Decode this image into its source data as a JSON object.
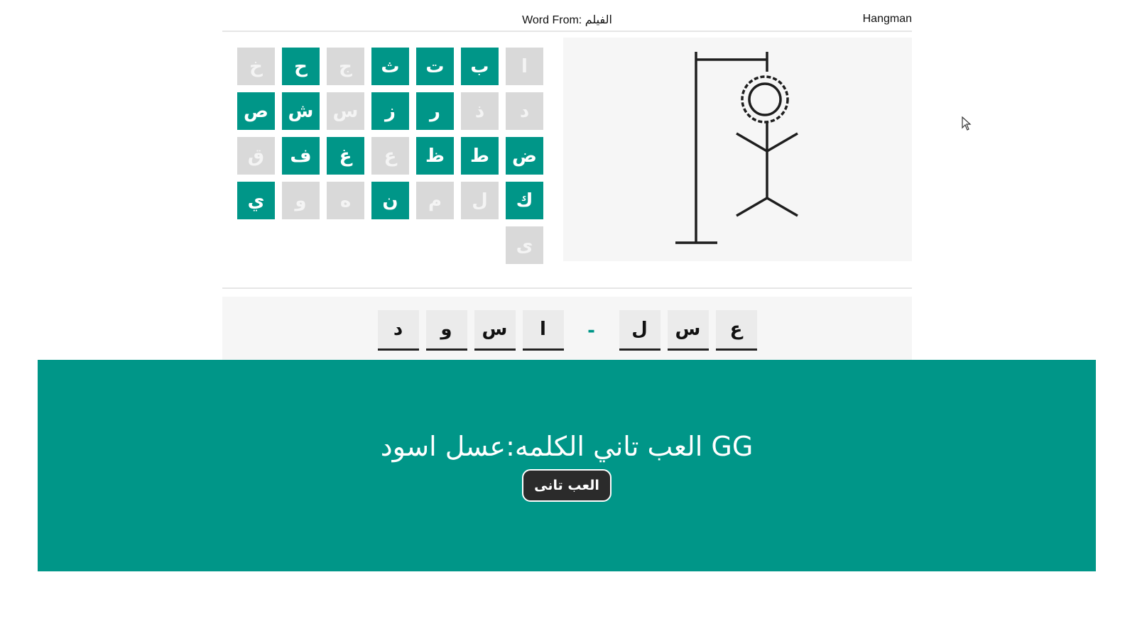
{
  "header": {
    "brand": "Hangman",
    "category": "Word From: الفيلم"
  },
  "letters": [
    {
      "char": "ا",
      "used": true
    },
    {
      "char": "ب",
      "used": false
    },
    {
      "char": "ت",
      "used": false
    },
    {
      "char": "ث",
      "used": false
    },
    {
      "char": "ج",
      "used": true
    },
    {
      "char": "ح",
      "used": false
    },
    {
      "char": "خ",
      "used": true
    },
    {
      "char": "د",
      "used": true
    },
    {
      "char": "ذ",
      "used": true
    },
    {
      "char": "ر",
      "used": false
    },
    {
      "char": "ز",
      "used": false
    },
    {
      "char": "س",
      "used": true
    },
    {
      "char": "ش",
      "used": false
    },
    {
      "char": "ص",
      "used": false
    },
    {
      "char": "ض",
      "used": false
    },
    {
      "char": "ط",
      "used": false
    },
    {
      "char": "ظ",
      "used": false
    },
    {
      "char": "ع",
      "used": true
    },
    {
      "char": "غ",
      "used": false
    },
    {
      "char": "ف",
      "used": false
    },
    {
      "char": "ق",
      "used": true
    },
    {
      "char": "ك",
      "used": false
    },
    {
      "char": "ل",
      "used": true
    },
    {
      "char": "م",
      "used": true
    },
    {
      "char": "ن",
      "used": false
    },
    {
      "char": "ه",
      "used": true
    },
    {
      "char": "و",
      "used": true
    },
    {
      "char": "ي",
      "used": false
    },
    {
      "char": "ى",
      "used": true
    }
  ],
  "guess": [
    "ع",
    "س",
    "ل",
    "-",
    "ا",
    "س",
    "و",
    "د"
  ],
  "popup": {
    "message": "GG العب تاني الكلمه:عسل اسود",
    "button": "العب تانى"
  },
  "colors": {
    "accent": "#009688",
    "used": "#d9d9d9",
    "button": "#2b2b2b"
  }
}
